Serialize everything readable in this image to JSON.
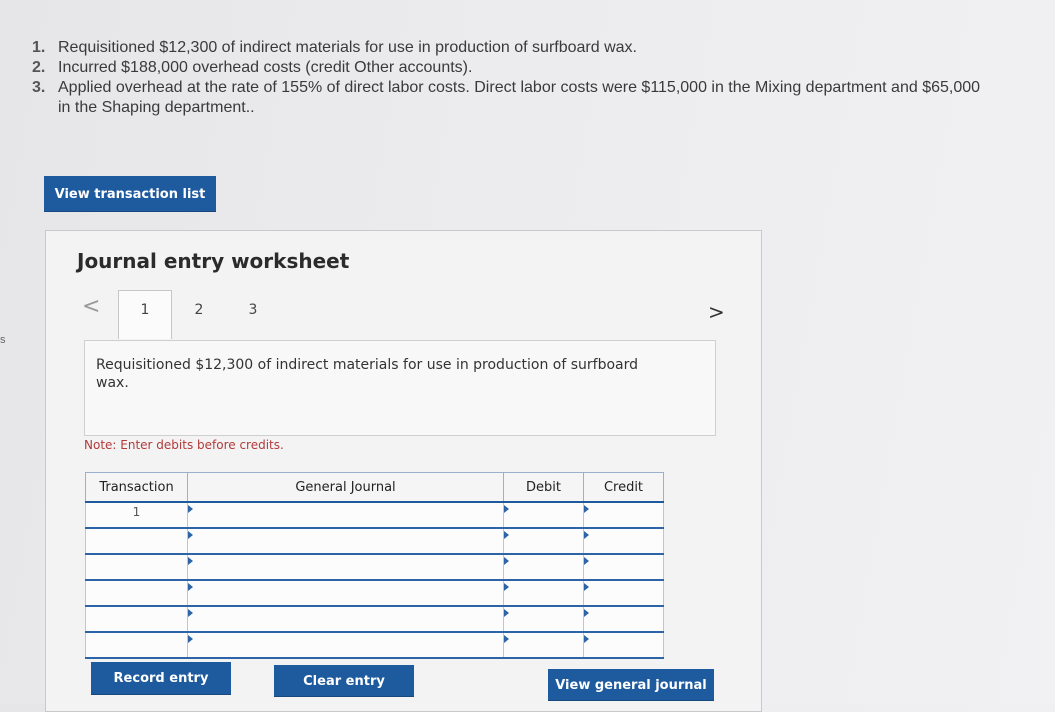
{
  "instructions": [
    {
      "num": "1.",
      "text": "Requisitioned $12,300 of indirect materials for use in production of surfboard wax."
    },
    {
      "num": "2.",
      "text": "Incurred $188,000 overhead costs (credit Other accounts)."
    },
    {
      "num": "3.",
      "text": "Applied overhead at the rate of 155% of direct labor costs. Direct labor costs were $115,000 in the Mixing department and $65,000\nin the Shaping department.."
    }
  ],
  "edge_char": "s",
  "view_transaction_list_label": "View transaction list",
  "worksheet": {
    "title": "Journal entry worksheet",
    "prev_arrow": "<",
    "next_arrow": ">",
    "tabs": [
      "1",
      "2",
      "3"
    ],
    "description": "Requisitioned $12,300 of indirect materials for use in production of surfboard wax.",
    "note": "Note: Enter debits before credits.",
    "table": {
      "headers": {
        "transaction": "Transaction",
        "account": "General Journal",
        "debit": "Debit",
        "credit": "Credit"
      },
      "rows": [
        {
          "transaction": "1",
          "account": "",
          "debit": "",
          "credit": ""
        },
        {
          "transaction": "",
          "account": "",
          "debit": "",
          "credit": ""
        },
        {
          "transaction": "",
          "account": "",
          "debit": "",
          "credit": ""
        },
        {
          "transaction": "",
          "account": "",
          "debit": "",
          "credit": ""
        },
        {
          "transaction": "",
          "account": "",
          "debit": "",
          "credit": ""
        },
        {
          "transaction": "",
          "account": "",
          "debit": "",
          "credit": ""
        }
      ]
    },
    "buttons": {
      "record": "Record entry",
      "clear": "Clear entry",
      "view_general_journal": "View general journal"
    }
  },
  "colors": {
    "button": "#1e5a9e",
    "note": "#b23a3a",
    "table_rule": "#2d64a8"
  }
}
